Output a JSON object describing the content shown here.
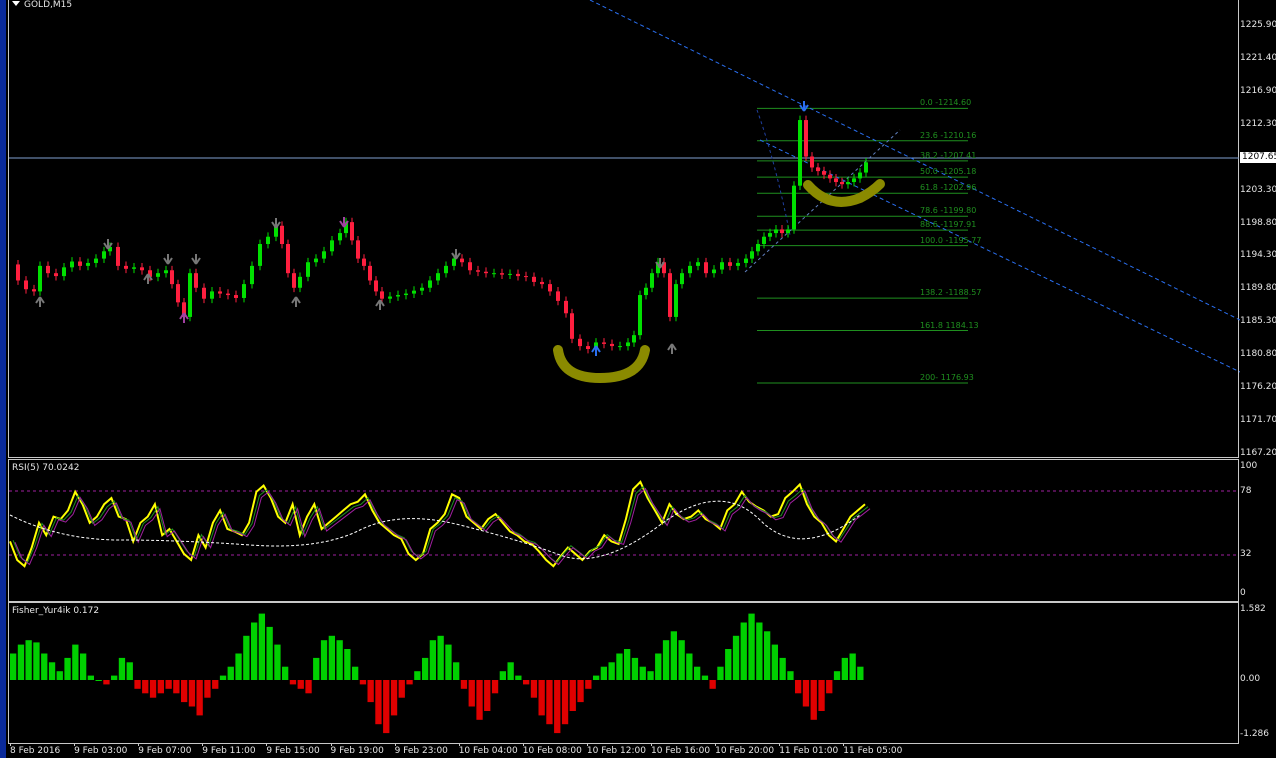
{
  "chart": {
    "symbol": "GOLD,M15",
    "price_scale": [
      "1225.90",
      "1221.40",
      "1216.90",
      "1212.30",
      "1207.65",
      "1203.30",
      "1198.80",
      "1194.30",
      "1189.80",
      "1185.30",
      "1180.80",
      "1176.20",
      "1171.70",
      "1167.20"
    ],
    "current_price": "1207.65",
    "time_labels": [
      "8 Feb 2016",
      "9 Feb 03:00",
      "9 Feb 07:00",
      "9 Feb 11:00",
      "9 Feb 15:00",
      "9 Feb 19:00",
      "9 Feb 23:00",
      "10 Feb 04:00",
      "10 Feb 08:00",
      "10 Feb 12:00",
      "10 Feb 16:00",
      "10 Feb 20:00",
      "11 Feb 01:00",
      "11 Feb 05:00"
    ],
    "fibonacci": [
      {
        "label": "0.0 -1214.60",
        "level": 1214.6
      },
      {
        "label": "23.6 -1210.16",
        "level": 1210.16
      },
      {
        "label": "38.2 -1207.41",
        "level": 1207.41
      },
      {
        "label": "50.0 -1205.18",
        "level": 1205.18
      },
      {
        "label": "61.8 -1202.96",
        "level": 1202.96
      },
      {
        "label": "78.6 -1199.80",
        "level": 1199.8
      },
      {
        "label": "88.6 -1197.91",
        "level": 1197.91
      },
      {
        "label": "100.0 -1195.77",
        "level": 1195.77
      },
      {
        "label": "138.2 -1188.57",
        "level": 1188.57
      },
      {
        "label": "161.8 1184.13",
        "level": 1184.13
      },
      {
        "label": "200- 1176.93",
        "level": 1176.93
      }
    ],
    "colors": {
      "bull": "#00e000",
      "bear": "#ff1f3f",
      "fib": "#1f8f1f",
      "trend": "#2a6ff0",
      "highlight": "#8a8a00",
      "rsi": "#ffff00",
      "fisher_up": "#00d000",
      "fisher_down": "#e00000"
    }
  },
  "rsi": {
    "label": "RSI(5) 70.0242",
    "scale": [
      "100",
      "78",
      "32",
      "0"
    ]
  },
  "fisher": {
    "label": "Fisher_Yur4ik 0.172",
    "scale": [
      "1.582",
      "0.00",
      "-1.286"
    ]
  }
}
